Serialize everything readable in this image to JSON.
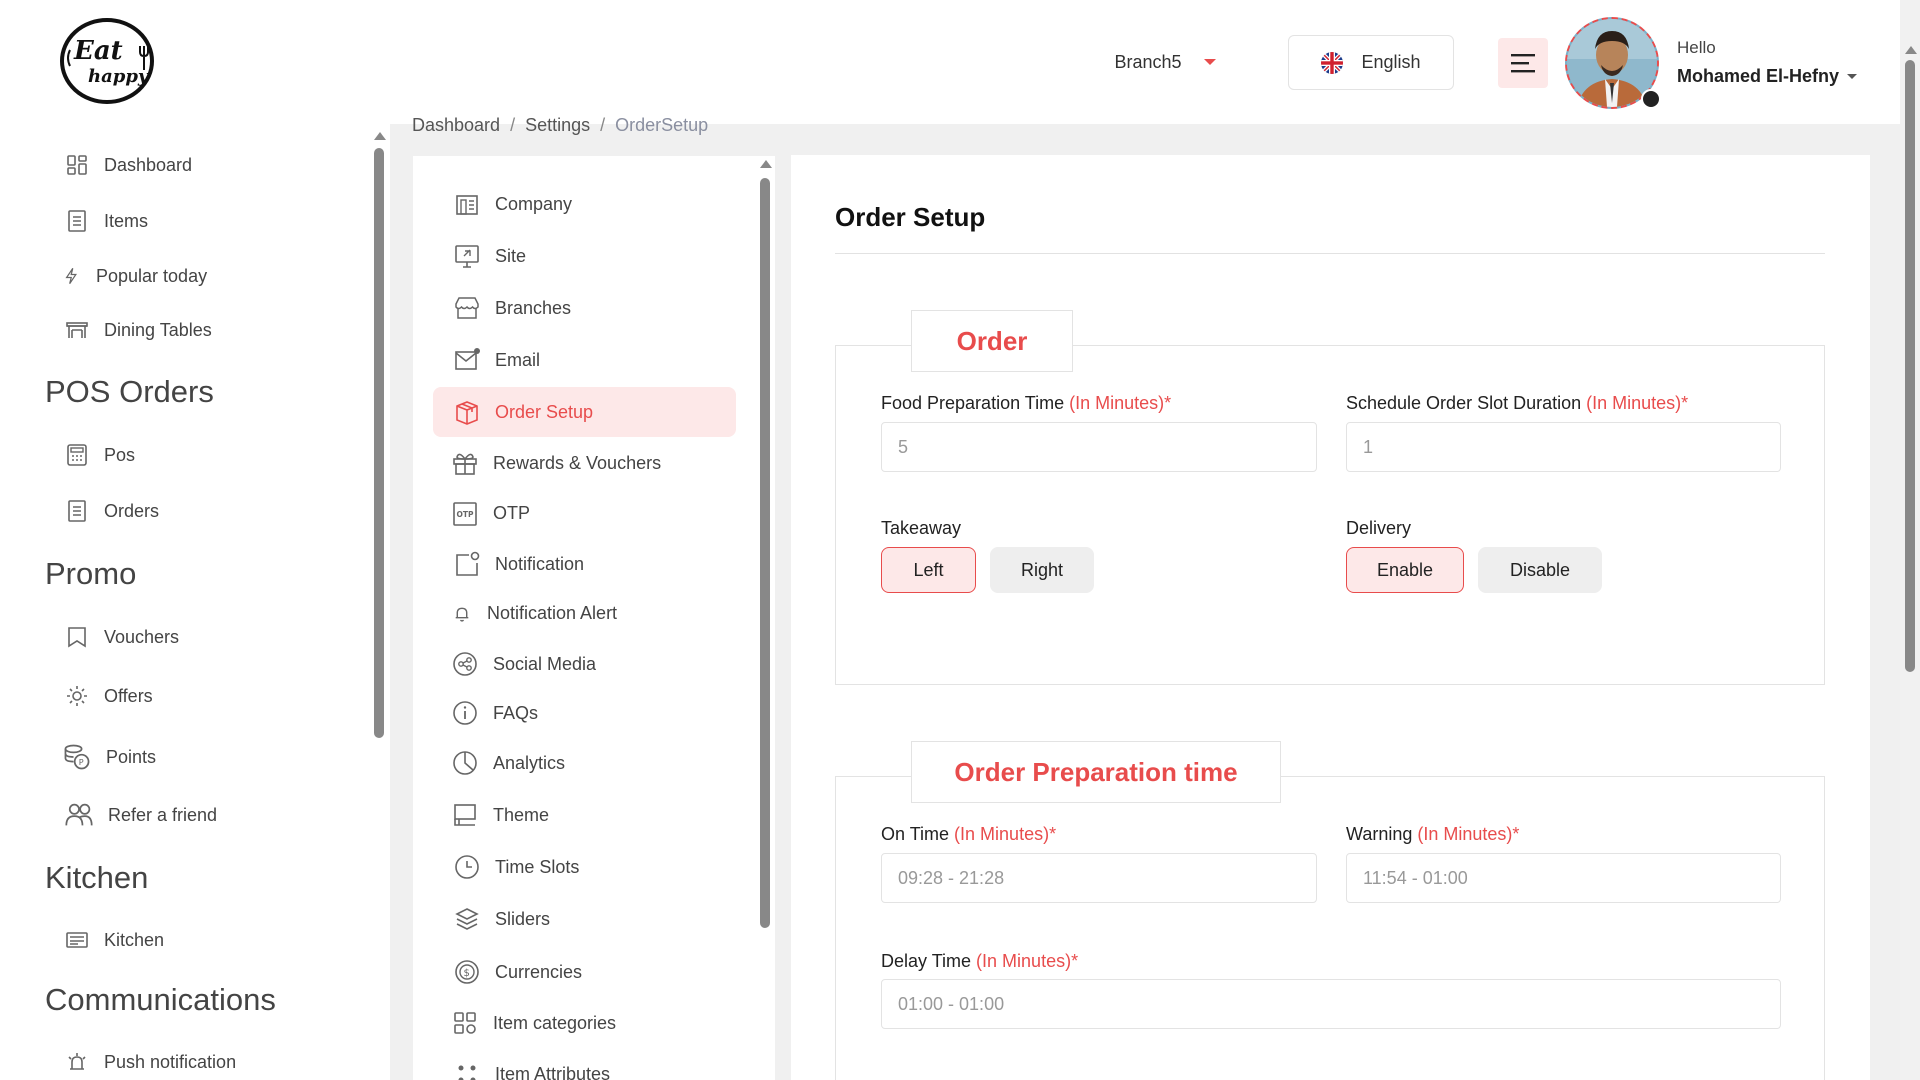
{
  "header": {
    "logo_text_top": "Eat",
    "logo_text_bottom": "happy",
    "branch": "Branch5",
    "language": "English",
    "greeting": "Hello",
    "user_name": "Mohamed El-Hefny"
  },
  "sidebar": {
    "items_top": [
      {
        "label": "Dashboard",
        "icon": "dashboard-icon"
      },
      {
        "label": "Items",
        "icon": "items-icon"
      },
      {
        "label": "Popular today",
        "icon": "lightning-icon"
      },
      {
        "label": "Dining Tables",
        "icon": "table-icon"
      }
    ],
    "sections": [
      {
        "title": "POS Orders",
        "items": [
          {
            "label": "Pos",
            "icon": "pos-icon"
          },
          {
            "label": "Orders",
            "icon": "orders-icon"
          }
        ]
      },
      {
        "title": "Promo",
        "items": [
          {
            "label": "Vouchers",
            "icon": "voucher-icon"
          },
          {
            "label": "Offers",
            "icon": "offers-icon"
          },
          {
            "label": "Points",
            "icon": "points-icon"
          },
          {
            "label": "Refer a friend",
            "icon": "refer-icon"
          }
        ]
      },
      {
        "title": "Kitchen",
        "items": [
          {
            "label": "Kitchen",
            "icon": "kitchen-icon"
          }
        ]
      },
      {
        "title": "Communications",
        "items": [
          {
            "label": "Push notification",
            "icon": "push-notification-icon"
          }
        ]
      }
    ]
  },
  "breadcrumb": [
    "Dashboard",
    "Settings",
    "OrderSetup"
  ],
  "settings_menu": {
    "active": "Order Setup",
    "items": [
      {
        "label": "Company",
        "icon": "company-icon"
      },
      {
        "label": "Site",
        "icon": "site-icon"
      },
      {
        "label": "Branches",
        "icon": "branches-icon"
      },
      {
        "label": "Email",
        "icon": "email-icon"
      },
      {
        "label": "Order Setup",
        "icon": "order-setup-icon"
      },
      {
        "label": "Rewards & Vouchers",
        "icon": "gift-icon"
      },
      {
        "label": "OTP",
        "icon": "otp-icon"
      },
      {
        "label": "Notification",
        "icon": "notification-icon"
      },
      {
        "label": "Notification Alert",
        "icon": "bell-icon"
      },
      {
        "label": "Social Media",
        "icon": "share-icon"
      },
      {
        "label": "FAQs",
        "icon": "info-icon"
      },
      {
        "label": "Analytics",
        "icon": "pie-chart-icon"
      },
      {
        "label": "Theme",
        "icon": "theme-icon"
      },
      {
        "label": "Time Slots",
        "icon": "clock-icon"
      },
      {
        "label": "Sliders",
        "icon": "layers-icon"
      },
      {
        "label": "Currencies",
        "icon": "currency-icon"
      },
      {
        "label": "Item categories",
        "icon": "categories-icon"
      },
      {
        "label": "Item Attributes",
        "icon": "attributes-icon"
      }
    ]
  },
  "main": {
    "title": "Order Setup",
    "order_section": {
      "tab": "Order",
      "food_prep_label": "Food Preparation Time",
      "food_prep_hint": "(In Minutes)*",
      "food_prep_value": "5",
      "schedule_label": "Schedule Order Slot Duration",
      "schedule_hint": "(In Minutes)*",
      "schedule_value": "1",
      "takeaway_label": "Takeaway",
      "takeaway_left": "Left",
      "takeaway_right": "Right",
      "takeaway_selected": "Left",
      "delivery_label": "Delivery",
      "delivery_enable": "Enable",
      "delivery_disable": "Disable",
      "delivery_selected": "Enable"
    },
    "prep_section": {
      "tab": "Order Preparation time",
      "on_time_label": "On Time",
      "on_time_hint": "(In Minutes)*",
      "on_time_value": "09:28 - 21:28",
      "warning_label": "Warning",
      "warning_hint": "(In Minutes)*",
      "warning_value": "11:54 - 01:00",
      "delay_label": "Delay Time",
      "delay_hint": "(In Minutes)*",
      "delay_value": "01:00 - 01:00"
    }
  },
  "colors": {
    "accent": "#e84c4c",
    "accent_light": "#fde8e8",
    "border": "#e3e3e3"
  }
}
